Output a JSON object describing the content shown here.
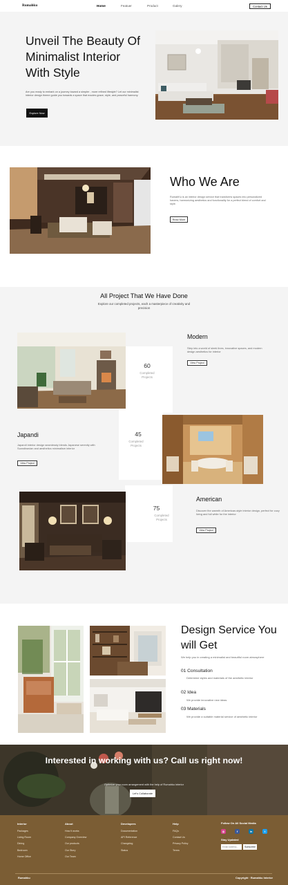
{
  "nav": {
    "brand": "Rumahku",
    "links": [
      "Home",
      "Featuer",
      "Product",
      "Galery"
    ],
    "contact": "Contact Us"
  },
  "hero": {
    "title": "Unveil The Beauty Of Minimalist Interior With Style",
    "description": "Are you ready to embark on a journey toward a simpler , more refined lifestyle? Let our minimalist interior design theme guide you towards a space that exudes grace, style, and peaceful harmony.",
    "button": "Explore Now"
  },
  "who": {
    "title": "Who We Are",
    "description": "RumahKu is an interior design service that transforms spaces into personalized havens, harmonizing aesthetics and functionality for a perfect blend of comfort and style.",
    "button": "Read More"
  },
  "projects": {
    "title": "All Project That We Have Done",
    "subtitle": "Explore our completed projects, each a masterpiece of creativity and precision",
    "items": [
      {
        "name": "Modern",
        "description": "Step into a world of sleek lines, innovative spaces, and modern design aesthetics for interior",
        "button": "View Project",
        "count": "60",
        "count_label": "Completed Projects"
      },
      {
        "name": "Japandi",
        "description": "Japandi interior design seamlessly blends Japanese serenity with Scandinavian and aesthetics minimalism interior",
        "button": "View Project",
        "count": "45",
        "count_label": "Completed Projects"
      },
      {
        "name": "American",
        "description": "Discover the warmth of American-style interior design, perfect for cozy living and full white for the interior",
        "button": "View Project",
        "count": "75",
        "count_label": "Completed Projects"
      }
    ]
  },
  "design": {
    "title": "Design Service You will Get",
    "description": "We help you in creating a minimalist and beautiful room atmosphere",
    "services": [
      {
        "title": "01 Consultation",
        "description": "Determine styles and materials of the aesthetic interior"
      },
      {
        "title": "02 Idea",
        "description": "We provide innovative new ideas"
      },
      {
        "title": "03 Materials",
        "description": "We provide a suitable material service of aesthetic interior"
      }
    ]
  },
  "cta": {
    "title": "Interested in working with us? Call us right now!",
    "subtitle": "Optimize your room arrangement with the help of Rumahku interior",
    "button": "Let's Collaborate"
  },
  "footer": {
    "columns": [
      {
        "heading": "Interior",
        "links": [
          "Packages",
          "Living Room",
          "Dining",
          "Bedroom",
          "Home Office"
        ]
      },
      {
        "heading": "About",
        "links": [
          "How It works",
          "Company Overview",
          "Our products",
          "Our Story",
          "Our Team"
        ]
      },
      {
        "heading": "Developers",
        "links": [
          "Documentation",
          "API Reference",
          "Changelog",
          "Status"
        ]
      },
      {
        "heading": "Help",
        "links": [
          "FAQs",
          "Contact Us",
          "Privacy Policy",
          "Terms"
        ]
      }
    ],
    "social_heading": "Follow On All Social Media",
    "social_icons": [
      "instagram-icon",
      "facebook-icon",
      "linkedin-icon",
      "twitter-icon"
    ],
    "stay_updated": "Stay Updated",
    "email_placeholder": "Email Address...",
    "subscribe": "Subscribe",
    "brand": "Rumahku",
    "copyright": "Copyright · Rumahku Interior"
  }
}
